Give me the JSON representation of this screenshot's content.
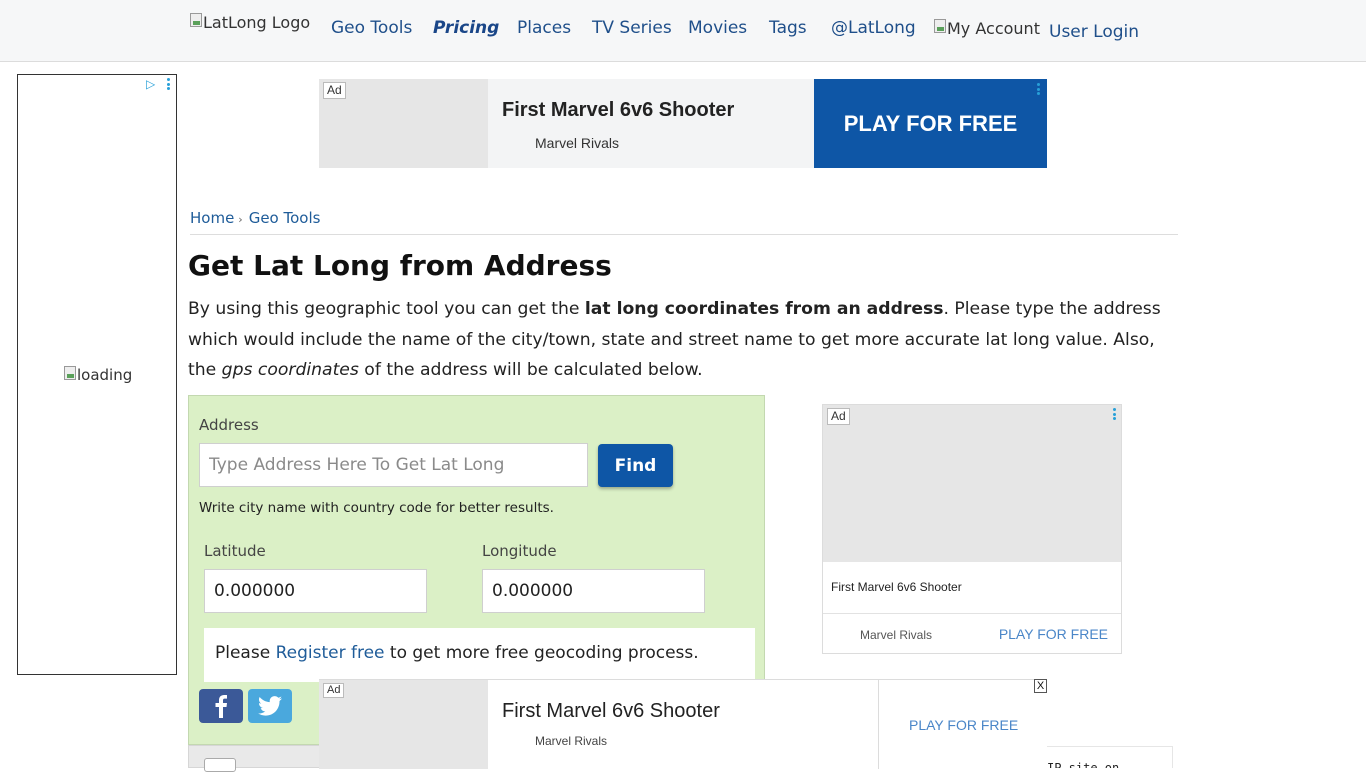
{
  "nav": {
    "logo_alt": "LatLong Logo",
    "items": [
      "Geo Tools",
      "Pricing",
      "Places",
      "TV Series",
      "Movies",
      "Tags",
      "@LatLong"
    ],
    "account_alt": "My Account",
    "login": "User Login"
  },
  "side_ad": {
    "loading_alt": "loading"
  },
  "banner_ad": {
    "ad_label": "Ad",
    "title": "First Marvel 6v6 Shooter",
    "brand": "Marvel Rivals",
    "cta": "PLAY FOR FREE"
  },
  "breadcrumb": {
    "home": "Home",
    "current": "Geo Tools"
  },
  "page": {
    "title": "Get Lat Long from Address",
    "intro_1": "By using this geographic tool you can get the ",
    "intro_bold": "lat long coordinates from an address",
    "intro_2": ". Please type the address which would include the name of the city/town, state and street name to get more accurate lat long value. Also, the ",
    "intro_italic": "gps coordinates",
    "intro_3": " of the address will be calculated below."
  },
  "form": {
    "address_label": "Address",
    "address_placeholder": "Type Address Here To Get Lat Long",
    "find_button": "Find",
    "hint": "Write city name with country code for better results.",
    "latitude_label": "Latitude",
    "latitude_value": "0.000000",
    "longitude_label": "Longitude",
    "longitude_value": "0.000000",
    "register_prefix": "Please ",
    "register_link": "Register free",
    "register_suffix": " to get more free geocoding process."
  },
  "card_ad": {
    "ad_label": "Ad",
    "title": "First Marvel 6v6 Shooter",
    "brand": "Marvel Rivals",
    "cta": "PLAY FOR FREE"
  },
  "sticky_ad": {
    "ad_label": "Ad",
    "title": "First Marvel 6v6 Shooter",
    "brand": "Marvel Rivals",
    "cta": "PLAY FOR FREE",
    "close": "X"
  },
  "partial_text": "IP site on",
  "colors": {
    "accent_blue": "#0e56a6",
    "link_blue": "#1f5c99",
    "form_green": "#dbf0c6",
    "facebook": "#3b5998",
    "twitter": "#4aa8dd"
  },
  "icons": [
    "adchoices-icon",
    "kebab-menu-icon",
    "facebook-icon",
    "twitter-icon",
    "broken-image-icon"
  ]
}
